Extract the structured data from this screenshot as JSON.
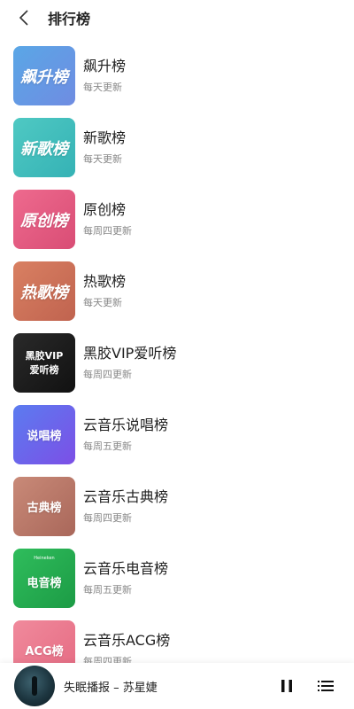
{
  "header": {
    "title": "排行榜"
  },
  "charts": [
    {
      "cover_text": "飙升榜",
      "title": "飙升榜",
      "update": "每天更新",
      "bg": "linear-gradient(135deg,#5aa7e6,#6f8ce2)"
    },
    {
      "cover_text": "新歌榜",
      "title": "新歌榜",
      "update": "每天更新",
      "bg": "linear-gradient(135deg,#4fc9c3,#35b2b5)"
    },
    {
      "cover_text": "原创榜",
      "title": "原创榜",
      "update": "每周四更新",
      "bg": "linear-gradient(135deg,#ee6a8e,#d94d75)"
    },
    {
      "cover_text": "热歌榜",
      "title": "热歌榜",
      "update": "每天更新",
      "bg": "linear-gradient(135deg,#d98062,#c0634f)"
    },
    {
      "cover_text": "黑胶VIP",
      "cover_sub": "爱听榜",
      "title": "黑胶VIP爱听榜",
      "update": "每周四更新",
      "bg": "linear-gradient(135deg,#2a2a2a,#111111)"
    },
    {
      "cover_text": "说唱榜",
      "title": "云音乐说唱榜",
      "update": "每周五更新",
      "bg": "linear-gradient(135deg,#5b7cf0,#7c4fe6)"
    },
    {
      "cover_text": "古典榜",
      "title": "云音乐古典榜",
      "update": "每周四更新",
      "bg": "linear-gradient(135deg,#c98a78,#a9675a)"
    },
    {
      "cover_text": "电音榜",
      "cover_logo": "Heineken",
      "title": "云音乐电音榜",
      "update": "每周五更新",
      "bg": "linear-gradient(135deg,#2fbd5c,#1c9b45)"
    },
    {
      "cover_text": "ACG榜",
      "title": "云音乐ACG榜",
      "update": "每周四更新",
      "bg": "linear-gradient(135deg,#f08a9c,#e56a82)"
    }
  ],
  "player": {
    "now_playing": "失眠播报 – 苏星婕"
  }
}
